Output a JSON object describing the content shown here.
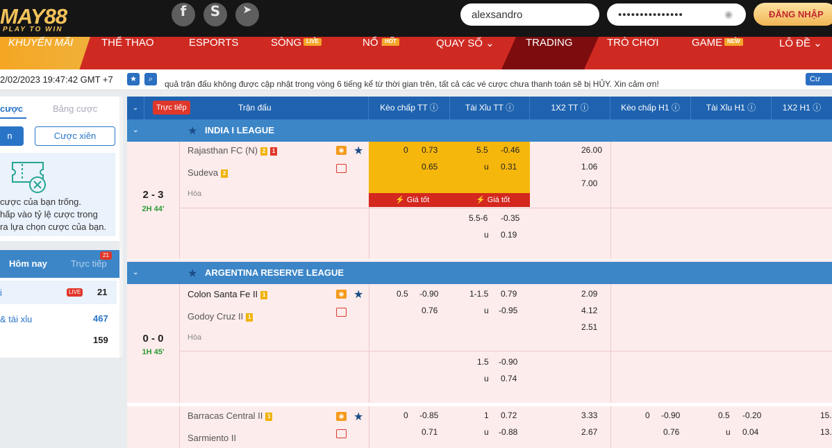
{
  "header": {
    "logo_text": "MAY88",
    "logo_tagline": "PLAY TO WIN",
    "social": [
      {
        "icon": "facebook-icon",
        "glyph": "f"
      },
      {
        "icon": "skype-icon",
        "glyph": "S"
      },
      {
        "icon": "telegram-icon",
        "glyph": "➤"
      }
    ],
    "username_value": "alexsandro",
    "password_value": "•••••••••••••••",
    "login_label": "ĐĂNG NHẬP"
  },
  "nav": {
    "promo": "KHUYẾN MÃI",
    "items": [
      {
        "label": "THỂ THAO"
      },
      {
        "label": "ESPORTS"
      },
      {
        "label": "SÒNG BÀI",
        "badge": "LIVE"
      },
      {
        "label": "NỔ HŨ",
        "badge": "HOT"
      },
      {
        "label": "QUAY SỐ ⌄"
      },
      {
        "label": "TRADING"
      },
      {
        "label": "TRÒ CHƠI"
      },
      {
        "label": "GAME BÀI",
        "badge": "NEW"
      },
      {
        "label": "LÔ ĐỀ ⌄"
      }
    ]
  },
  "subbar": {
    "datetime": "2/02/2023 19:47:42 GMT +7",
    "marquee_line2": "quả trận đấu không được cập nhật trong vòng 6 tiếng kể từ thời gian trên, tất cả các vé cược chưa thanh toán sẽ bị HỦY. Xin cảm ơn!",
    "right_btn": "Cư"
  },
  "sidebar": {
    "tab_bet": "cược",
    "tab_board": "Bảng cược",
    "btn_single": "n",
    "btn_parlay": "Cược xiên",
    "empty_line1": "cược của bạn trống.",
    "empty_line2": "hấp vào tỷ lệ cược trong",
    "empty_line3": "ra lựa chọn cược của bạn.",
    "tab_today": "Hôm nay",
    "tab_live": "Trực tiếp",
    "live_count_badge": "21",
    "rows": [
      {
        "label": "i",
        "badge": "LIVE",
        "count": "21"
      },
      {
        "label": "& tài xỉu",
        "count": "467"
      },
      {
        "label": "",
        "count": "159"
      }
    ]
  },
  "table": {
    "live_label": "Trực tiếp",
    "headers": [
      "Trận đấu",
      "Kèo chấp TT",
      "Tài Xỉu TT",
      "1X2 TT",
      "Kèo chấp H1",
      "Tài Xỉu H1",
      "1X2 H1"
    ],
    "best_price": "Giá tốt",
    "leagues": [
      {
        "name": "INDIA I LEAGUE",
        "match": {
          "score": "2 - 3",
          "time": "2H 44'",
          "home": "Rajasthan FC (N)",
          "home_yellow": "2",
          "home_red": "1",
          "away": "Sudeva",
          "away_yellow": "2",
          "draw": "Hòa",
          "hdp_line": "0",
          "hdp_home": "0.73",
          "hdp_away": "0.65",
          "ou_line": "5.5",
          "ou_over": "-0.46",
          "ou_u": "u",
          "ou_under": "0.31",
          "x12": [
            "26.00",
            "1.06",
            "7.00"
          ],
          "alt_ou_line": "5.5-6",
          "alt_ou_over": "-0.35",
          "alt_ou_u": "u",
          "alt_ou_under": "0.19"
        }
      },
      {
        "name": "ARGENTINA RESERVE LEAGUE",
        "match": {
          "score": "0 - 0",
          "time": "1H 45'",
          "home": "Colon Santa Fe II",
          "home_yellow": "1",
          "away": "Godoy Cruz II",
          "away_yellow": "1",
          "draw": "Hòa",
          "hdp_line": "0.5",
          "hdp_home": "-0.90",
          "hdp_away": "0.76",
          "ou_line": "1-1.5",
          "ou_over": "0.79",
          "ou_u": "u",
          "ou_under": "-0.95",
          "x12": [
            "2.09",
            "4.12",
            "2.51"
          ],
          "alt_ou_line": "1.5",
          "alt_ou_over": "-0.90",
          "alt_ou_u": "u",
          "alt_ou_under": "0.74"
        }
      }
    ],
    "third_match": {
      "home": "Barracas Central II",
      "home_yellow": "1",
      "away": "Sarmiento II",
      "hdp_line": "0",
      "hdp_home": "-0.85",
      "hdp_away": "0.71",
      "ou_line": "1",
      "ou_over": "0.72",
      "ou_u": "u",
      "ou_under": "-0.88",
      "x12": [
        "3.33",
        "2.67"
      ],
      "h1_hdp_line": "0",
      "h1_hdp_home": "-0.90",
      "h1_hdp_away": "0.76",
      "h1_ou_line": "0.5",
      "h1_ou_over": "-0.20",
      "h1_ou_u": "u",
      "h1_ou_under": "0.04",
      "h1_x12": [
        "15.",
        "13."
      ]
    }
  }
}
